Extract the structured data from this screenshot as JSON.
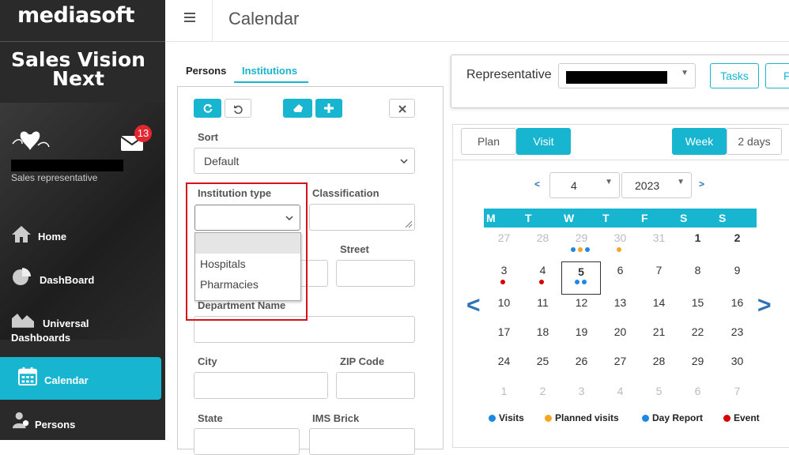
{
  "brand": {
    "logo": "mediasoft",
    "app_name_line1": "Sales Vision",
    "app_name_line2": "Next"
  },
  "user": {
    "role": "Sales representative",
    "mail_count": "13"
  },
  "nav": [
    {
      "label": "Home",
      "icon": "home-icon"
    },
    {
      "label": "DashBoard",
      "icon": "pie-chart-icon"
    },
    {
      "label": "Universal",
      "label2": "Dashboards",
      "icon": "area-chart-icon"
    },
    {
      "label": "Calendar",
      "icon": "calendar-icon",
      "active": true
    },
    {
      "label": "Persons",
      "icon": "persons-icon"
    }
  ],
  "header": {
    "title": "Calendar"
  },
  "tabs": [
    {
      "label": "Persons"
    },
    {
      "label": "Institutions",
      "active": true
    }
  ],
  "filters": {
    "sort_label": "Sort",
    "sort_value": "Default",
    "institution_type_label": "Institution type",
    "institution_type_value": "",
    "institution_type_options": [
      "",
      "Hospitals",
      "Pharmacies"
    ],
    "classification_label": "Classification",
    "street_label": "Street",
    "department_label": "Department Name",
    "city_label": "City",
    "zip_label": "ZIP Code",
    "state_label": "State",
    "ims_label": "IMS Brick"
  },
  "representative": {
    "label": "Representative",
    "tasks_label": "Tasks",
    "next_label": "F"
  },
  "view": {
    "plan": "Plan",
    "visit": "Visit",
    "week": "Week",
    "two_days": "2 days"
  },
  "calendar": {
    "month": "4",
    "year": "2023",
    "weekdays": [
      "M",
      "T",
      "W",
      "T",
      "F",
      "S",
      "S"
    ],
    "weeks": [
      [
        "27",
        "28",
        "29",
        "30",
        "31",
        "1",
        "2"
      ],
      [
        "3",
        "4",
        "5",
        "6",
        "7",
        "8",
        "9"
      ],
      [
        "10",
        "11",
        "12",
        "13",
        "14",
        "15",
        "16"
      ],
      [
        "17",
        "18",
        "19",
        "20",
        "21",
        "22",
        "23"
      ],
      [
        "24",
        "25",
        "26",
        "27",
        "28",
        "29",
        "30"
      ],
      [
        "1",
        "2",
        "3",
        "4",
        "5",
        "6",
        "7"
      ]
    ],
    "today": "5"
  },
  "legend": [
    {
      "label": "Visits",
      "color": "#1e88e5"
    },
    {
      "label": "Planned visits",
      "color": "#f5a623"
    },
    {
      "label": "Day Report",
      "color": "#1e88e5"
    },
    {
      "label": "Event",
      "color": "#d50000"
    }
  ]
}
